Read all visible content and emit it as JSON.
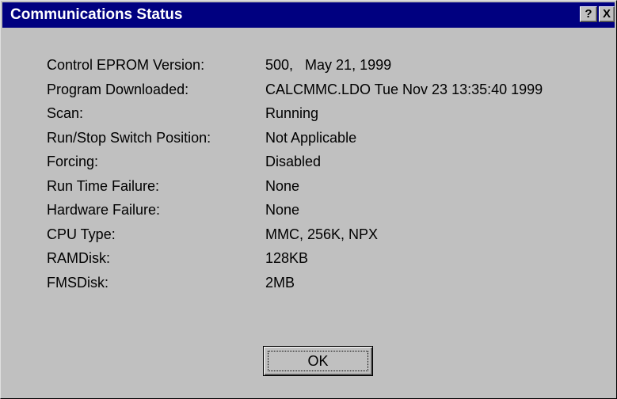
{
  "window": {
    "title": "Communications Status",
    "help_button": "?",
    "close_button": "X"
  },
  "status_fields": [
    {
      "label": "Control EPROM Version:",
      "value": "500,   May 21, 1999"
    },
    {
      "label": "Program Downloaded:",
      "value": "CALCMMC.LDO Tue Nov 23 13:35:40 1999"
    },
    {
      "label": "Scan:",
      "value": "Running"
    },
    {
      "label": "Run/Stop Switch Position:",
      "value": "Not Applicable"
    },
    {
      "label": "Forcing:",
      "value": "Disabled"
    },
    {
      "label": "Run Time Failure:",
      "value": "None"
    },
    {
      "label": "Hardware Failure:",
      "value": "None"
    },
    {
      "label": "CPU Type:",
      "value": "MMC, 256K, NPX"
    },
    {
      "label": "RAMDisk:",
      "value": "128KB"
    },
    {
      "label": "FMSDisk:",
      "value": "2MB"
    }
  ],
  "buttons": {
    "ok_label": "OK"
  },
  "colors": {
    "titlebar": "#000080",
    "title_text": "#ffffff",
    "dialog_face": "#c0c0c0"
  }
}
